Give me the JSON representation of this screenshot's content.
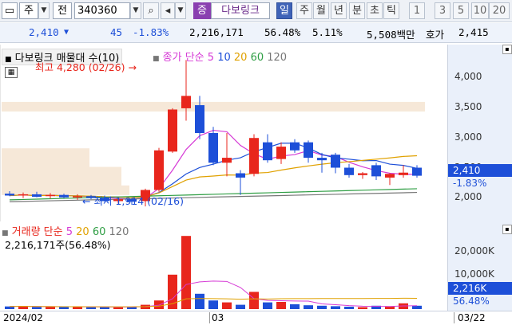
{
  "toolbar": {
    "market": "주",
    "period": "전",
    "code": "340360",
    "badge": "증",
    "stock_name": "다보링크",
    "buttons": [
      "일",
      "주",
      "월",
      "년",
      "분",
      "초",
      "틱"
    ],
    "active_button": "일",
    "numbers": [
      "1",
      "3",
      "5",
      "10",
      "20"
    ]
  },
  "quote": {
    "price": "2,410",
    "change": "45",
    "change_pct": "-1.83%",
    "volume": "2,216,171",
    "vol_ratio": "56.48%",
    "turnover": "5.11%",
    "amount": "5,508백만",
    "ask_label": "호가",
    "ask": "2,415"
  },
  "price_pane": {
    "title": "다보링크 매물대 수(10)",
    "legend_label": "종가 단순",
    "ma": [
      "5",
      "10",
      "20",
      "60",
      "120"
    ],
    "high_note": "최고 4,280 (02/26)",
    "low_note": "최저 1,914 (02/16)",
    "current_price": "2,410",
    "current_pct": "-1.83%"
  },
  "vol_pane": {
    "legend_label": "거래량 단순",
    "ma": [
      "5",
      "20",
      "60",
      "120"
    ],
    "summary": "2,216,171주(56.48%)",
    "current_vol": "2,216K",
    "current_pct": "56.48%"
  },
  "y_ticks": [
    "4,000",
    "3,500",
    "3,000",
    "2,500",
    "2,000"
  ],
  "vol_ticks": [
    "20,000K",
    "10,000K"
  ],
  "x_labels": [
    "2024/02",
    "03",
    "03/22"
  ],
  "colors": {
    "up": "#e8261c",
    "down": "#1d4fd8",
    "ma5": "#d63bd6",
    "ma10": "#1d4fd8",
    "ma20": "#e0a100",
    "ma60": "#2f9e44",
    "ma120": "#777777"
  },
  "chart_data": {
    "type": "candlestick",
    "title": "다보링크 매물대 수(10)",
    "ylim": [
      1800,
      4400
    ],
    "candles": [
      {
        "o": 2120,
        "h": 2160,
        "l": 2080,
        "c": 2090
      },
      {
        "o": 2090,
        "h": 2140,
        "l": 2050,
        "c": 2110
      },
      {
        "o": 2110,
        "h": 2150,
        "l": 2060,
        "c": 2070
      },
      {
        "o": 2080,
        "h": 2130,
        "l": 2040,
        "c": 2100
      },
      {
        "o": 2100,
        "h": 2120,
        "l": 2050,
        "c": 2060
      },
      {
        "o": 2060,
        "h": 2110,
        "l": 2020,
        "c": 2080
      },
      {
        "o": 2080,
        "h": 2100,
        "l": 2030,
        "c": 2050
      },
      {
        "o": 2050,
        "h": 2090,
        "l": 1990,
        "c": 2000
      },
      {
        "o": 2000,
        "h": 2060,
        "l": 1960,
        "c": 2030
      },
      {
        "o": 2030,
        "h": 2050,
        "l": 1940,
        "c": 1990
      },
      {
        "o": 2000,
        "h": 2200,
        "l": 1914,
        "c": 2180
      },
      {
        "o": 2180,
        "h": 2860,
        "l": 2150,
        "c": 2820
      },
      {
        "o": 2800,
        "h": 3500,
        "l": 2780,
        "c": 3480
      },
      {
        "o": 3500,
        "h": 4280,
        "l": 3300,
        "c": 3700
      },
      {
        "o": 3550,
        "h": 3700,
        "l": 3000,
        "c": 3100
      },
      {
        "o": 3100,
        "h": 3200,
        "l": 2580,
        "c": 2620
      },
      {
        "o": 2620,
        "h": 3100,
        "l": 2400,
        "c": 2700
      },
      {
        "o": 2450,
        "h": 2500,
        "l": 2100,
        "c": 2380
      },
      {
        "o": 2440,
        "h": 3080,
        "l": 2400,
        "c": 3020
      },
      {
        "o": 2950,
        "h": 3080,
        "l": 2620,
        "c": 2660
      },
      {
        "o": 2680,
        "h": 2950,
        "l": 2600,
        "c": 2880
      },
      {
        "o": 2950,
        "h": 3000,
        "l": 2780,
        "c": 2820
      },
      {
        "o": 2950,
        "h": 2980,
        "l": 2620,
        "c": 2700
      },
      {
        "o": 2700,
        "h": 2780,
        "l": 2460,
        "c": 2660
      },
      {
        "o": 2750,
        "h": 2780,
        "l": 2450,
        "c": 2540
      },
      {
        "o": 2540,
        "h": 2600,
        "l": 2380,
        "c": 2420
      },
      {
        "o": 2420,
        "h": 2470,
        "l": 2360,
        "c": 2450
      },
      {
        "o": 2580,
        "h": 2620,
        "l": 2340,
        "c": 2400
      },
      {
        "o": 2380,
        "h": 2450,
        "l": 2260,
        "c": 2440
      },
      {
        "o": 2420,
        "h": 2580,
        "l": 2380,
        "c": 2460
      },
      {
        "o": 2540,
        "h": 2580,
        "l": 2380,
        "c": 2410
      }
    ],
    "volume": [
      550,
      600,
      450,
      500,
      420,
      480,
      400,
      450,
      380,
      500,
      900,
      1800,
      7200,
      15300,
      3200,
      1800,
      1400,
      900,
      3600,
      1400,
      1500,
      1000,
      800,
      700,
      600,
      500,
      400,
      700,
      500,
      1200,
      700
    ]
  }
}
